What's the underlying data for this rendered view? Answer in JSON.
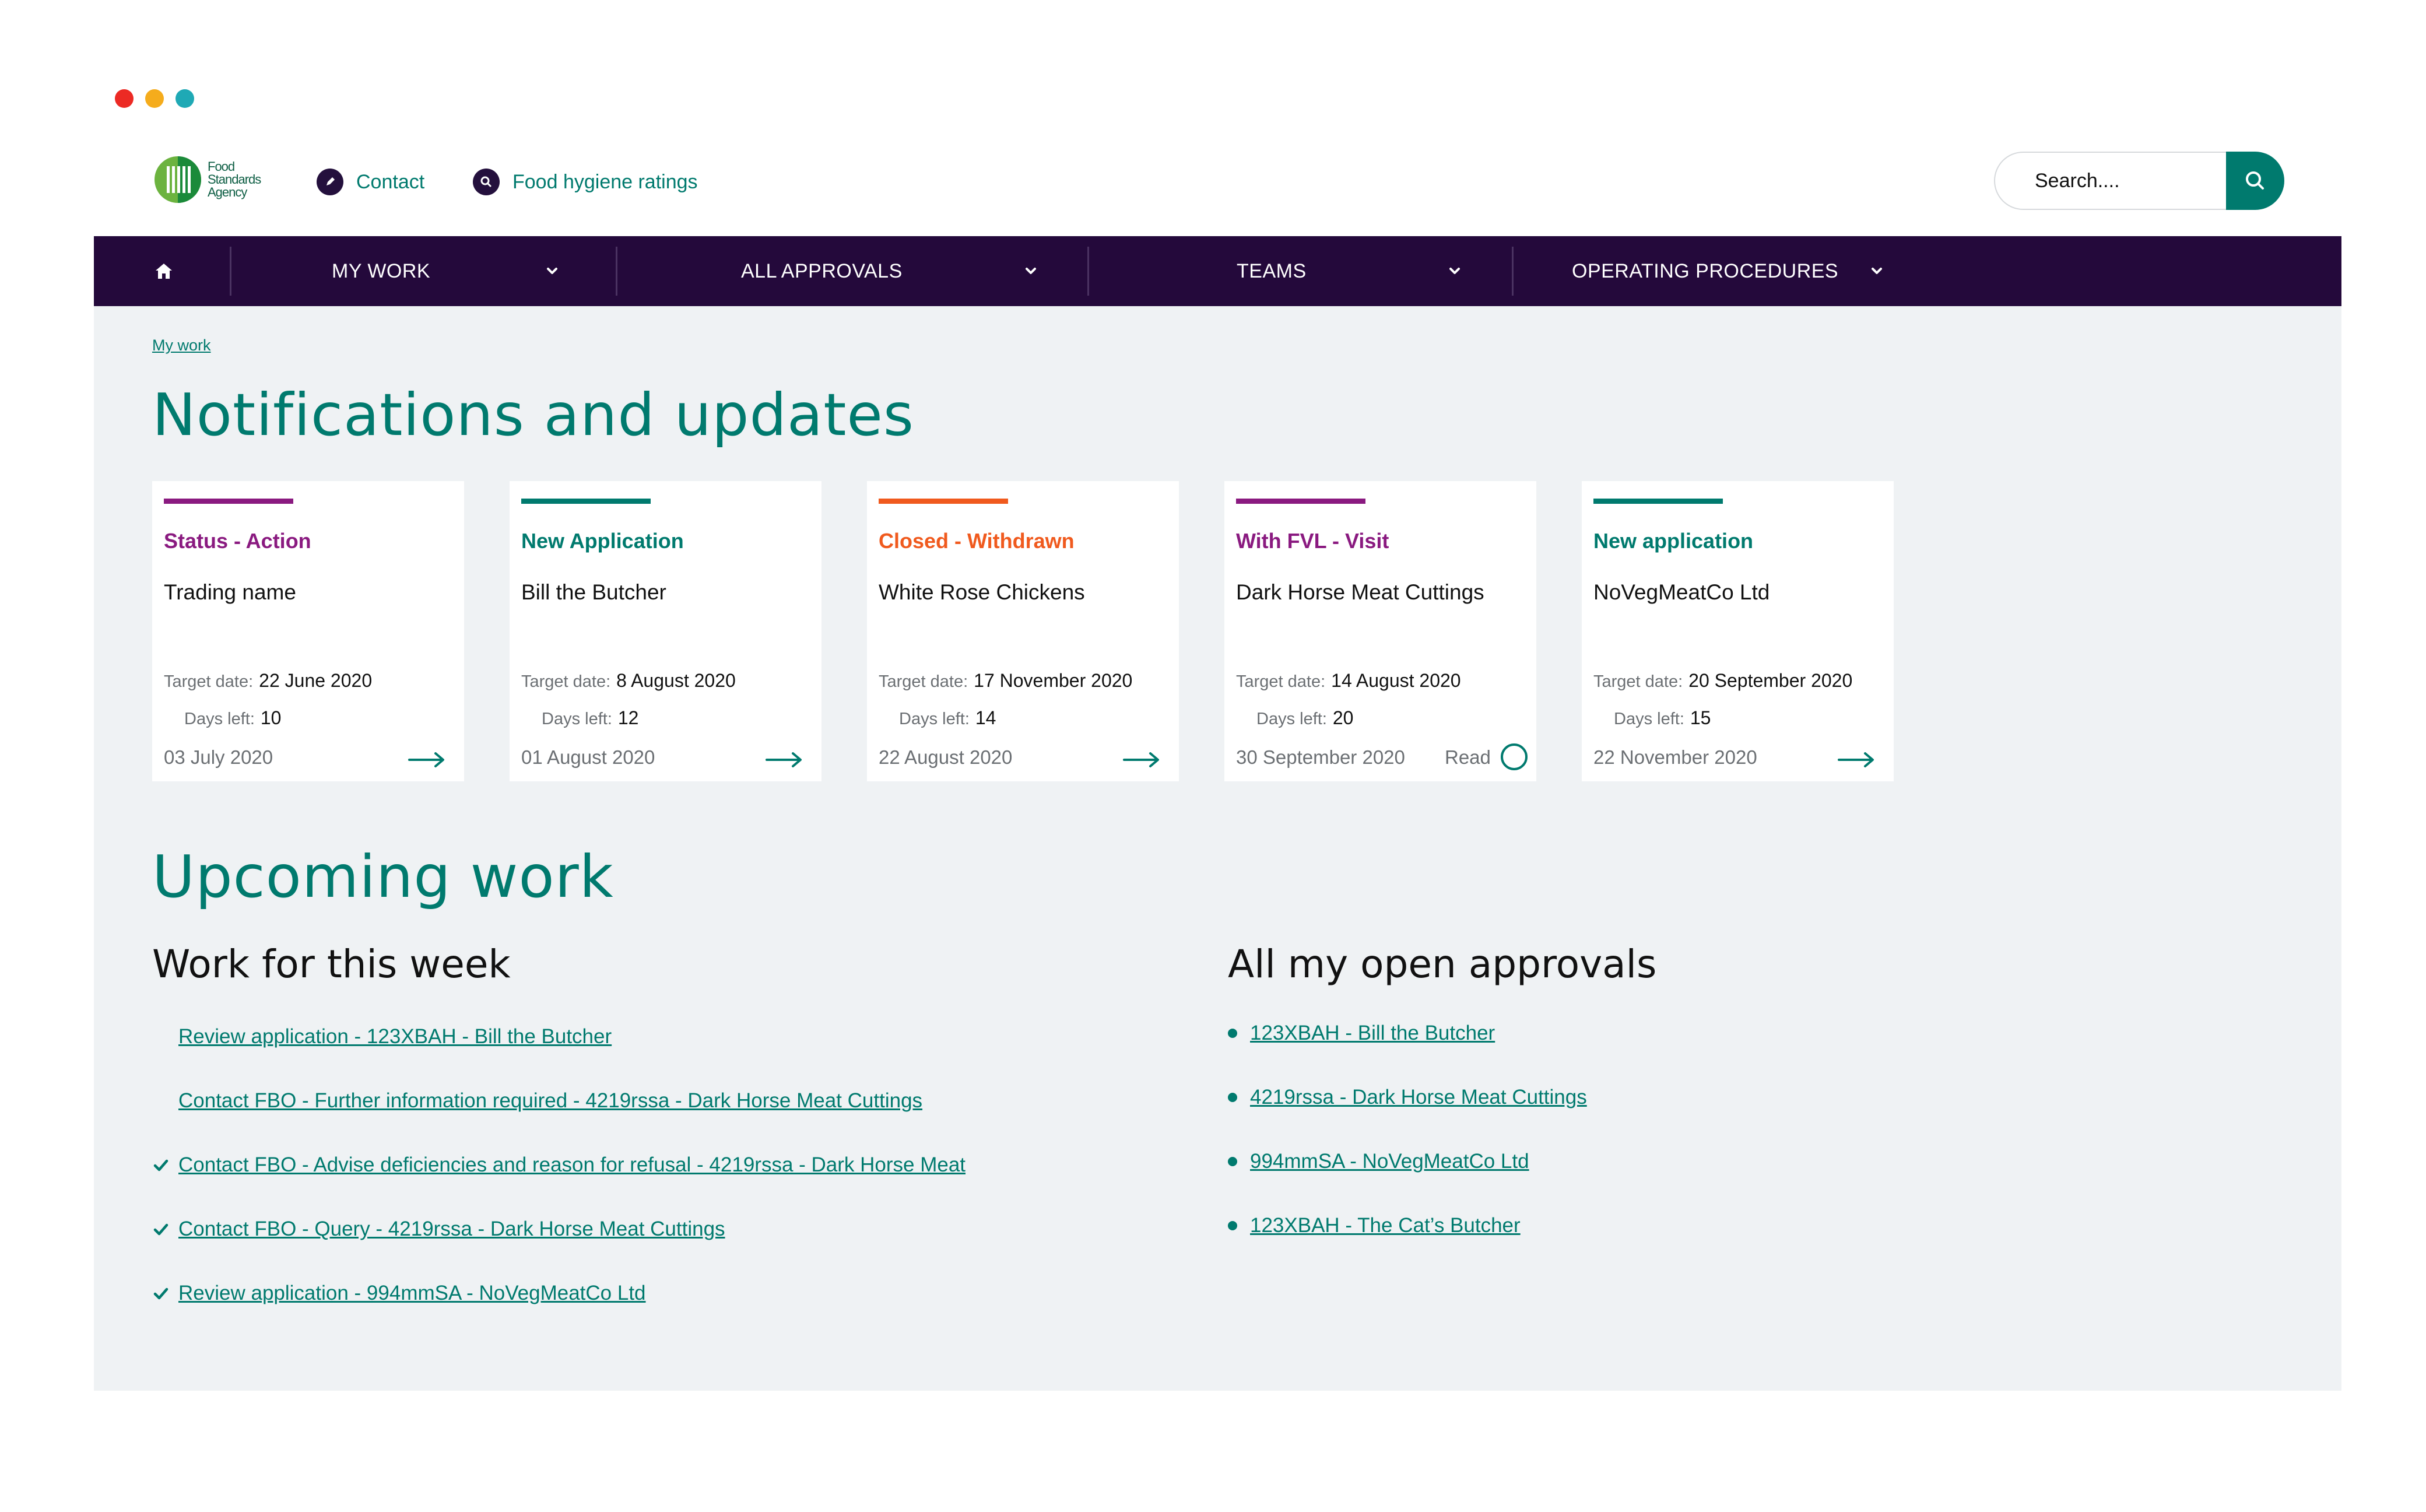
{
  "window": {
    "dots": [
      "#ec2a24",
      "#f5ac1c",
      "#1fa9b5"
    ]
  },
  "header": {
    "logo_lines": [
      "Food",
      "Standards",
      "Agency"
    ],
    "links": [
      {
        "label": "Contact",
        "icon": "pencil-icon"
      },
      {
        "label": "Food hygiene ratings",
        "icon": "search-icon"
      }
    ],
    "search": {
      "placeholder": "Search....",
      "icon": "search-icon"
    }
  },
  "nav": {
    "home_icon": "home-icon",
    "items": [
      {
        "label": "MY WORK",
        "icon": "chevron-down-icon"
      },
      {
        "label": "ALL APPROVALS",
        "icon": "chevron-down-icon"
      },
      {
        "label": "TEAMS",
        "icon": "chevron-down-icon"
      },
      {
        "label": "OPERATING PROCEDURES",
        "icon": "chevron-down-icon"
      }
    ]
  },
  "breadcrumb": "My work",
  "notifications": {
    "title": "Notifications and updates",
    "target_label": "Target date:",
    "days_label": "Days left:",
    "cards": [
      {
        "status": "Status - Action",
        "color": "#8a1a80",
        "trading": "Trading name",
        "target_date": "22 June 2020",
        "days_left": "10",
        "date": "03 July 2020",
        "read": ""
      },
      {
        "status": "New Application",
        "color": "#007a6e",
        "trading": "Bill the Butcher",
        "target_date": "8 August 2020",
        "days_left": "12",
        "date": "01 August 2020",
        "read": ""
      },
      {
        "status": "Closed - Withdrawn",
        "color": "#f05a1e",
        "trading": "White Rose Chickens",
        "target_date": "17 November 2020",
        "days_left": "14",
        "date": "22 August 2020",
        "read": ""
      },
      {
        "status": "With FVL - Visit",
        "color": "#8a1a80",
        "trading": "Dark Horse Meat Cuttings",
        "target_date": "14 August 2020",
        "days_left": "20",
        "date": "30 September 2020",
        "read": "Read"
      },
      {
        "status": "New application",
        "color": "#007a6e",
        "trading": "NoVegMeatCo Ltd",
        "target_date": "20 September 2020",
        "days_left": "15",
        "date": "22 November 2020",
        "read": ""
      }
    ]
  },
  "upcoming": {
    "title": "Upcoming work",
    "week": {
      "title": "Work for this week",
      "tasks": [
        {
          "label": "Review application - 123XBAH - Bill the Butcher",
          "done": false
        },
        {
          "label": "Contact FBO - Further information required - 4219rssa - Dark Horse Meat Cuttings",
          "done": false
        },
        {
          "label": "Contact FBO - Advise deficiencies and reason for refusal - 4219rssa - Dark Horse Meat",
          "done": true
        },
        {
          "label": "Contact FBO - Query - 4219rssa - Dark Horse Meat Cuttings",
          "done": true
        },
        {
          "label": "Review application - 994mmSA - NoVegMeatCo Ltd",
          "done": true
        }
      ]
    },
    "approvals": {
      "title": "All my open approvals",
      "items": [
        "123XBAH - Bill the Butcher",
        "4219rssa - Dark Horse Meat Cuttings",
        "994mmSA - NoVegMeatCo Ltd",
        "123XBAH - The Cat’s Butcher"
      ]
    }
  }
}
